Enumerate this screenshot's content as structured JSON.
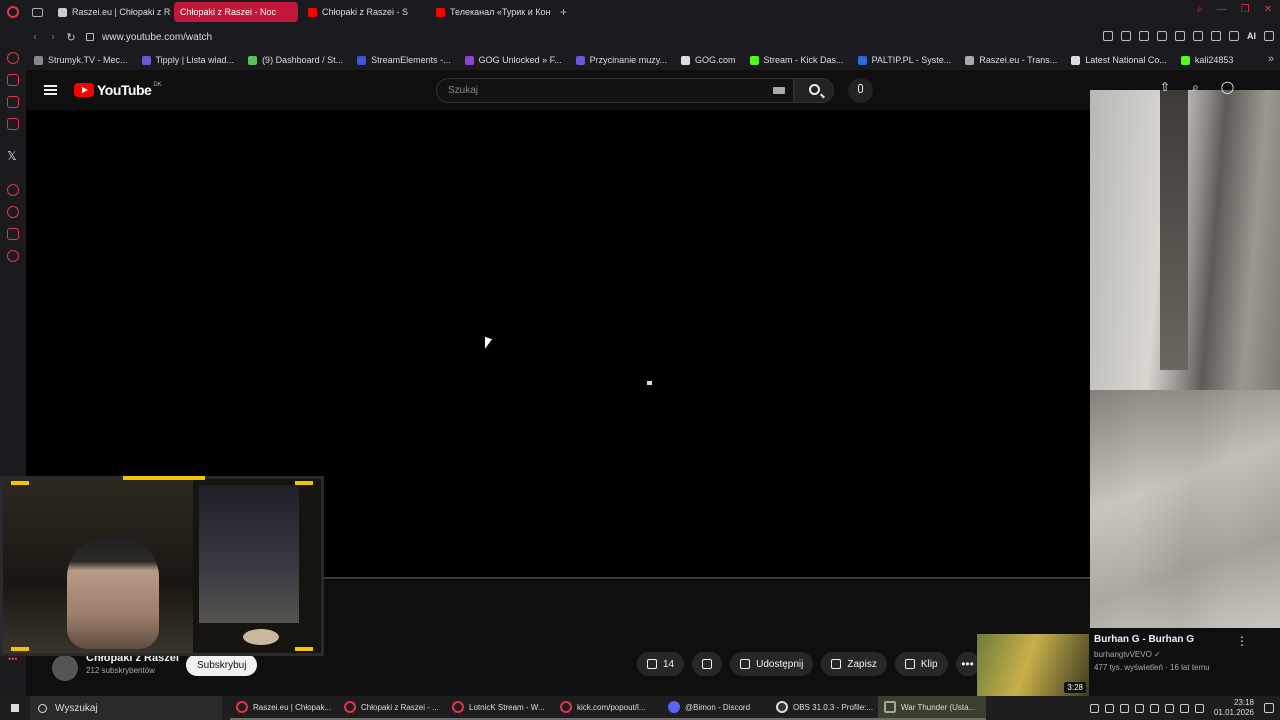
{
  "browser": {
    "tabs": [
      {
        "label": "Raszei.eu | Chłopaki z Ras",
        "active": false,
        "favicon": "opera-icon"
      },
      {
        "label": "Chłopaki z Raszei - Noc",
        "active": true,
        "favicon": "opera-icon"
      },
      {
        "label": "Chłopaki z Raszei - S",
        "active": false,
        "favicon": "youtube-icon"
      },
      {
        "label": "Телеканал «Турик и Кон",
        "active": false,
        "favicon": "youtube-icon"
      }
    ],
    "url": "www.youtube.com/watch",
    "ai_label": "AI",
    "bookmarks": [
      {
        "label": "Strumyk.TV - Mec...",
        "color": "#888888"
      },
      {
        "label": "Tipply | Lista wiad...",
        "color": "#6a5acd"
      },
      {
        "label": "(9) Dashboard / St...",
        "color": "#53c35b"
      },
      {
        "label": "StreamElements -...",
        "color": "#3a5bd9"
      },
      {
        "label": "GOG Unlocked » F...",
        "color": "#8e3fd6"
      },
      {
        "label": "Przycinanie muzy...",
        "color": "#6b5bd6"
      },
      {
        "label": "GOG.com",
        "color": "#dddddd"
      },
      {
        "label": "Stream - Kick Das...",
        "color": "#53fc18"
      },
      {
        "label": "PALTIP.PL - Syste...",
        "color": "#2a6ad8"
      },
      {
        "label": "Raszei.eu - Trans...",
        "color": "#aaaaaa"
      },
      {
        "label": "Latest National Co...",
        "color": "#dddddd"
      },
      {
        "label": "kali24853",
        "color": "#53fc18"
      }
    ]
  },
  "youtube": {
    "logo_text": "YouTube",
    "country_code": "DK",
    "search_placeholder": "Szukaj",
    "channel_name": "Chłopaki z Raszei",
    "subscribers": "212 subskrybentów",
    "subscribe_label": "Subskrybuj",
    "like_count": "14",
    "share_label": "Udostępnij",
    "save_label": "Zapisz",
    "clip_label": "Klip",
    "recommended": {
      "title": "Burhan G - Burhan G",
      "channel": "burhangtvVEVO",
      "meta": "477 tys. wyświetleń · 16 lat temu",
      "duration": "3:28"
    }
  },
  "taskbar": {
    "search_label": "Wyszukaj",
    "items": [
      {
        "label": "Raszei.eu | Chłopak...",
        "kind": "opera"
      },
      {
        "label": "Chłopaki z Raszei - ...",
        "kind": "opera"
      },
      {
        "label": "LotnicK Stream - W...",
        "kind": "opera"
      },
      {
        "label": "kick.com/popout/l...",
        "kind": "opera"
      },
      {
        "label": "@Bimon - Discord",
        "kind": "discord"
      },
      {
        "label": "OBS 31.0.3 - Profile:...",
        "kind": "obs"
      },
      {
        "label": "War Thunder (Usta...",
        "kind": "war"
      }
    ],
    "time": "23:18",
    "date": "01.01.2026"
  },
  "colors": {
    "accent": "#e0364a",
    "active_tab": "#c2183a",
    "youtube_red": "#ff0000",
    "webcam_frame": "#f5c400"
  }
}
